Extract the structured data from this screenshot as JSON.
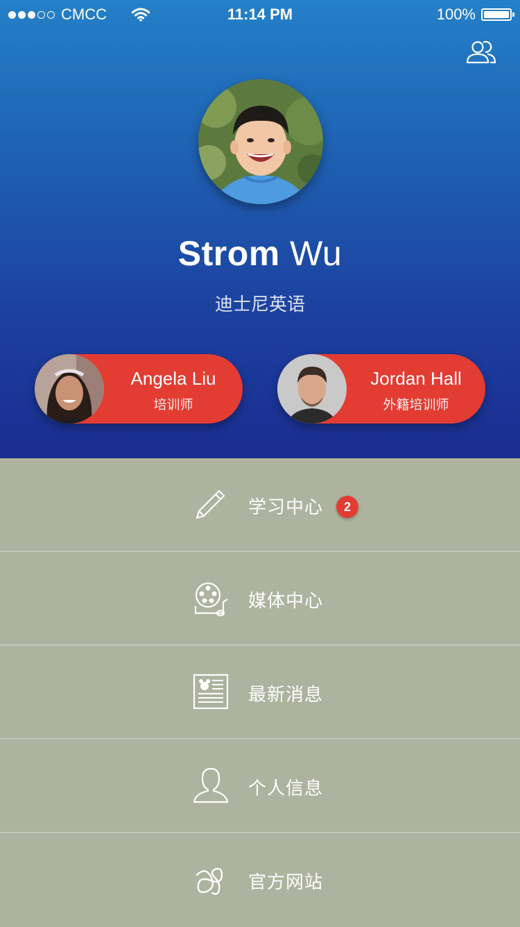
{
  "status_bar": {
    "carrier": "CMCC",
    "time": "11:14 PM",
    "battery": "100%",
    "signal_bars_filled": 3,
    "signal_bars_total": 5
  },
  "header": {
    "group_icon": "group-users-icon",
    "profile": {
      "first_name": "Strom",
      "last_name": "Wu",
      "school": "迪士尼英语"
    },
    "trainers": [
      {
        "name": "Angela Liu",
        "role": "培训师"
      },
      {
        "name": "Jordan Hall",
        "role": "外籍培训师"
      }
    ]
  },
  "menu": {
    "items": [
      {
        "label": "学习中心",
        "icon": "pencil-icon",
        "badge": "2"
      },
      {
        "label": "媒体中心",
        "icon": "film-reel-music-icon"
      },
      {
        "label": "最新消息",
        "icon": "newspaper-icon"
      },
      {
        "label": "个人信息",
        "icon": "person-icon"
      },
      {
        "label": "官方网站",
        "icon": "website-logo-icon"
      }
    ]
  },
  "colors": {
    "header_top": "#2480c8",
    "header_bottom": "#1a2d8f",
    "accent_red": "#e33c32",
    "menu_bg": "#adb39e"
  }
}
